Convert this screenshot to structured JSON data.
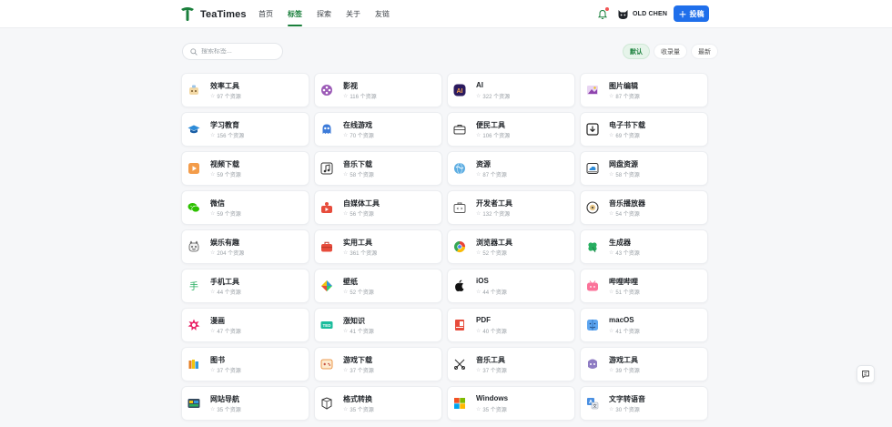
{
  "brand": {
    "name": "TeaTimes",
    "color": "#1a7f3c"
  },
  "nav": [
    {
      "label": "首页",
      "active": false
    },
    {
      "label": "标签",
      "active": true
    },
    {
      "label": "探索",
      "active": false
    },
    {
      "label": "关于",
      "active": false
    },
    {
      "label": "友链",
      "active": false
    }
  ],
  "user": {
    "name": "OLD CHEN"
  },
  "submit": {
    "label": "投稿"
  },
  "search": {
    "placeholder": "搜索标签..."
  },
  "sort": [
    {
      "label": "默认",
      "active": true
    },
    {
      "label": "收录量",
      "active": false
    },
    {
      "label": "最新",
      "active": false
    }
  ],
  "tags": [
    {
      "name": "效率工具",
      "count": "97 个资源",
      "icon": "productivity-icon"
    },
    {
      "name": "影视",
      "count": "116 个资源",
      "icon": "film-reel-icon"
    },
    {
      "name": "AI",
      "count": "322 个资源",
      "icon": "ai-icon"
    },
    {
      "name": "图片编辑",
      "count": "87 个资源",
      "icon": "image-edit-icon"
    },
    {
      "name": "学习教育",
      "count": "156 个资源",
      "icon": "graduation-cap-icon"
    },
    {
      "name": "在线游戏",
      "count": "70 个资源",
      "icon": "ghost-icon"
    },
    {
      "name": "便民工具",
      "count": "106 个资源",
      "icon": "briefcase-icon"
    },
    {
      "name": "电子书下载",
      "count": "69 个资源",
      "icon": "download-box-icon"
    },
    {
      "name": "视频下载",
      "count": "59 个资源",
      "icon": "video-download-icon"
    },
    {
      "name": "音乐下载",
      "count": "58 个资源",
      "icon": "music-download-icon"
    },
    {
      "name": "资源",
      "count": "87 个资源",
      "icon": "globe-icon"
    },
    {
      "name": "网盘资源",
      "count": "58 个资源",
      "icon": "cloud-drive-icon"
    },
    {
      "name": "微信",
      "count": "59 个资源",
      "icon": "wechat-icon"
    },
    {
      "name": "自媒体工具",
      "count": "56 个资源",
      "icon": "media-creator-icon"
    },
    {
      "name": "开发者工具",
      "count": "132 个资源",
      "icon": "code-toolbox-icon"
    },
    {
      "name": "音乐播放器",
      "count": "54 个资源",
      "icon": "vinyl-icon"
    },
    {
      "name": "娱乐有趣",
      "count": "204 个资源",
      "icon": "fun-face-icon"
    },
    {
      "name": "实用工具",
      "count": "361 个资源",
      "icon": "toolbox-icon"
    },
    {
      "name": "浏览器工具",
      "count": "52 个资源",
      "icon": "browser-icon"
    },
    {
      "name": "生成器",
      "count": "43 个资源",
      "icon": "clover-icon"
    },
    {
      "name": "手机工具",
      "count": "44 个资源",
      "icon": "hand-char-icon"
    },
    {
      "name": "壁纸",
      "count": "52 个资源",
      "icon": "wallpaper-icon"
    },
    {
      "name": "iOS",
      "count": "44 个资源",
      "icon": "apple-icon"
    },
    {
      "name": "哔哩哔哩",
      "count": "51 个资源",
      "icon": "bilibili-icon"
    },
    {
      "name": "漫画",
      "count": "47 个资源",
      "icon": "comic-icon"
    },
    {
      "name": "涨知识",
      "count": "41 个资源",
      "icon": "knowledge-icon"
    },
    {
      "name": "PDF",
      "count": "40 个资源",
      "icon": "pdf-icon"
    },
    {
      "name": "macOS",
      "count": "41 个资源",
      "icon": "finder-icon"
    },
    {
      "name": "图书",
      "count": "37 个资源",
      "icon": "books-icon"
    },
    {
      "name": "游戏下载",
      "count": "37 个资源",
      "icon": "gamepad-icon"
    },
    {
      "name": "音乐工具",
      "count": "37 个资源",
      "icon": "music-tools-icon"
    },
    {
      "name": "游戏工具",
      "count": "39 个资源",
      "icon": "game-tools-icon"
    },
    {
      "name": "网站导航",
      "count": "35 个资源",
      "icon": "navigation-icon"
    },
    {
      "name": "格式转换",
      "count": "35 个资源",
      "icon": "convert-icon"
    },
    {
      "name": "Windows",
      "count": "35 个资源",
      "icon": "windows-icon"
    },
    {
      "name": "文字转语音",
      "count": "30 个资源",
      "icon": "text-to-speech-icon"
    }
  ]
}
